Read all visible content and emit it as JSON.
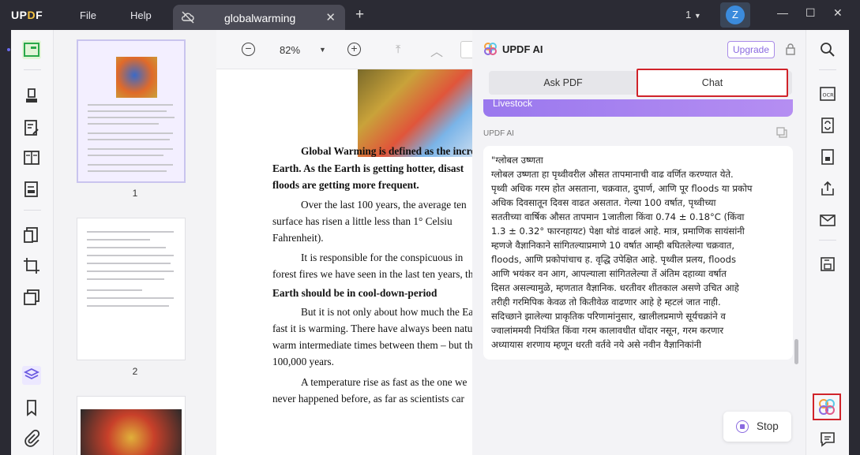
{
  "app": {
    "logo": "UPDF",
    "menu": [
      "File",
      "Help"
    ],
    "tab_title": "globalwarming",
    "page_selector": "1",
    "avatar_initial": "Z"
  },
  "doc_toolbar": {
    "zoom": "82%"
  },
  "thumbnails": {
    "pages": [
      "1",
      "2"
    ]
  },
  "document": {
    "lines": [
      {
        "text": "Global Warming is defined as the incre",
        "bold": true,
        "indent": true
      },
      {
        "text": "Earth. As the Earth is getting hotter, disast",
        "bold": true
      },
      {
        "text": "floods are getting more frequent.",
        "bold": true
      },
      {
        "text": "Over the last 100 years, the average ten",
        "bold": false,
        "indent": true
      },
      {
        "text": "surface has risen a little less than 1° Celsiu",
        "bold": false
      },
      {
        "text": "Fahrenheit).",
        "bold": false
      },
      {
        "text": "It is responsible for the conspicuous in",
        "bold": false,
        "indent": true
      },
      {
        "text": "forest fires we have seen in the last ten years, tho",
        "bold": false
      },
      {
        "text": "Earth should be in cool-down-period",
        "bold": true
      },
      {
        "text": "But it is not only about how much the Ea",
        "bold": false,
        "indent": true
      },
      {
        "text": "fast it is warming. There have always been natura",
        "bold": false
      },
      {
        "text": "warm intermediate times between them – but tho",
        "bold": false
      },
      {
        "text": "100,000 years.",
        "bold": false
      },
      {
        "text": "A temperature rise as fast as the one we",
        "bold": false,
        "indent": true
      },
      {
        "text": "never happened before, as far as scientists car",
        "bold": false
      }
    ]
  },
  "ai_panel": {
    "title": "UPDF AI",
    "upgrade_label": "Upgrade",
    "tabs": [
      "Ask PDF",
      "Chat"
    ],
    "active_tab": "Chat",
    "prev_message_snippet": "Livestock",
    "answer_label": "UPDF AI",
    "answer_text": "\"ग्लोबल उष्णता\nग्लोबल उष्णता हा पृथ्वीवरील औसत तापमानाची वाढ वर्णित करण्यात येते.\nपृथ्वी अधिक गरम होत असताना, चक्रवात, दुपार्ण, आणि पूर floods या प्रकोप\nअधिक दिवसातून दिवस वाढत असतात. गेल्या 100 वर्षात, पृथ्वीच्या\nसततीच्या वार्षिक औसत तापमान 1जातीला किंवा 0.74 ± 0.18°C (किंवा\n1.3 ± 0.32° फारनहायट) पेक्षा थोडं वाढलं आहे. मात्र, प्रमाणिक सायंसांनी\nम्हणजे वैज्ञानिकाने सांगितल्याप्रमाणे 10 वर्षात आम्ही बघितलेल्या चक्रवात,\nfloods, आणि प्रकोपांचाच ह. वृद्धि उपेक्षित आहे. पृथ्वील प्रलय, floods\nआणि भयंकर वन आग, आपल्याला सांगितलेल्या तें अंतिम दहाव्या वर्षात\nदिसत असल्यामुळे, म्हणतात वैज्ञानिक. धरतीवर शीतकाल असणे उचित आहे\nतरीही गरमिपिक केवळ तो कितीवेळ वाढणार आहे हे म्हटलं जात नाही.\nसदिच्छाने झालेल्या प्राकृतिक परिणामांनुसार, खालीलप्रमाणे सूर्यचक्रांने व\nज्वालांममयी नियंत्रित किंवा गरम कालावधीत धोंदार नसून, गरम करणार\nअध्यायास शरणाय म्हणून धरती वर्तवे नये असे नवीन वैज्ञानिकांनी",
    "stop_label": "Stop"
  },
  "colors": {
    "accent_purple": "#8a6ae0",
    "highlight_red": "#d0232a",
    "titlebar": "#2b2b34"
  }
}
